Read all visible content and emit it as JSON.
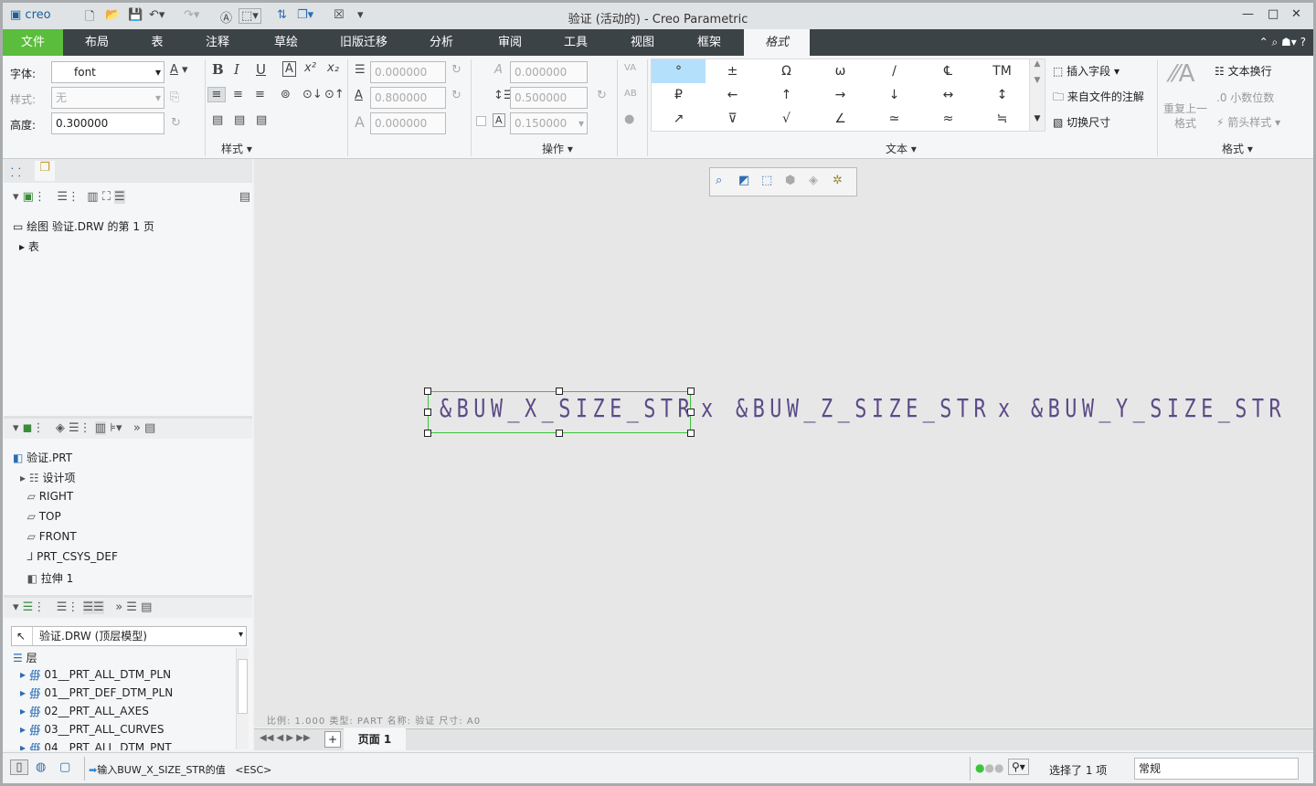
{
  "titlebar": {
    "logo": "creo",
    "title": "验证 (活动的) - Creo Parametric",
    "icons": [
      "new-icon",
      "open-icon",
      "save-icon",
      "undo-icon",
      "redo-icon",
      "text-icon",
      "select-box-icon",
      "regenerate-icon",
      "windows-icon",
      "close-window-icon",
      "customize-icon"
    ]
  },
  "menu": {
    "tabs": [
      "文件",
      "布局",
      "表",
      "注释",
      "草绘",
      "旧版迁移",
      "分析",
      "审阅",
      "工具",
      "视图",
      "框架",
      "格式"
    ],
    "active": "格式"
  },
  "style_group": {
    "font_label": "字体:",
    "font_value": "font",
    "style_label": "样式:",
    "style_value": "无",
    "height_label": "高度:",
    "height_value": "0.300000",
    "group": "样式"
  },
  "format_values": {
    "v1": "0.000000",
    "v2": "0.800000",
    "v3": "0.000000",
    "group_label": "操作"
  },
  "ops_values": {
    "v1": "0.000000",
    "v2": "0.500000",
    "v3": "0.150000"
  },
  "symbols": [
    "°",
    "±",
    "Ω",
    "ω",
    "/",
    "℄",
    "TM",
    "₽",
    "←",
    "↑",
    "→",
    "↓",
    "↔",
    "↕",
    "↗",
    "⊽",
    "√",
    "∠",
    "≃",
    "≈",
    "≒"
  ],
  "text_group": {
    "insert_field": "插入字段",
    "notes_from_file": "来自文件的注解",
    "toggle_dim": "切换尺寸",
    "group": "文本"
  },
  "format_group": {
    "repeat": "重复上一",
    "repeat2": "格式",
    "wrap": "文本换行",
    "decimals": "小数位数",
    "arrow_style": "箭头样式",
    "group": "格式"
  },
  "drawing_tree": {
    "root": "绘图 验证.DRW 的第 1 页",
    "child": "表"
  },
  "model_tree": {
    "root": "验证.PRT",
    "items": [
      "设计项",
      "RIGHT",
      "TOP",
      "FRONT",
      "PRT_CSYS_DEF",
      "拉伸 1"
    ]
  },
  "layer_tree": {
    "model_select": "验证.DRW (顶层模型)",
    "root": "层",
    "items": [
      "01__PRT_ALL_DTM_PLN",
      "01__PRT_DEF_DTM_PLN",
      "02__PRT_ALL_AXES",
      "03__PRT_ALL_CURVES",
      "04__PRT_ALL_DTM_PNT"
    ]
  },
  "canvas": {
    "note1": "&BUW_X_SIZE_STR",
    "sep1": "x",
    "note2": "&BUW_Z_SIZE_STR",
    "sep2": "x",
    "note3": "&BUW_Y_SIZE_STR",
    "sheet_info": "比例: 1.000   类型: PART   名称: 验证   尺寸: A0"
  },
  "pagebar": {
    "add": "+",
    "page": "页面 1"
  },
  "status": {
    "message": "输入BUW_X_SIZE_STR的值",
    "esc": "<ESC>",
    "selected": "选择了 1 项",
    "filter": "常规"
  }
}
